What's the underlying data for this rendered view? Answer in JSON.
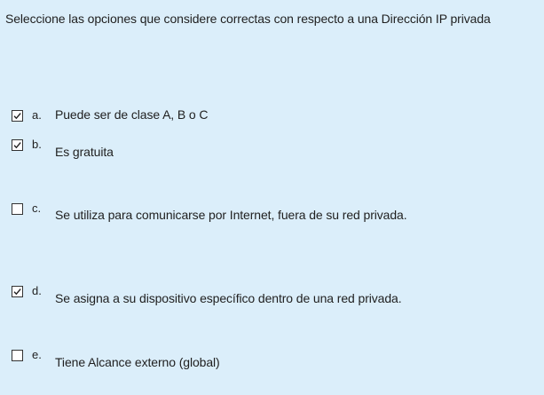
{
  "question": {
    "text": "Seleccione las opciones que considere correctas con respecto a una Dirección IP privada"
  },
  "options": [
    {
      "letter": "a.",
      "text": "Puede ser de clase A, B o C",
      "checked": true
    },
    {
      "letter": "b.",
      "text": "Es gratuita",
      "checked": true
    },
    {
      "letter": "c.",
      "text": "Se utiliza para comunicarse por Internet, fuera de su red privada.",
      "checked": false
    },
    {
      "letter": "d.",
      "text": "Se asigna a su dispositivo específico dentro de una red privada.",
      "checked": true
    },
    {
      "letter": "e.",
      "text": "Tiene Alcance externo (global)",
      "checked": false
    }
  ]
}
